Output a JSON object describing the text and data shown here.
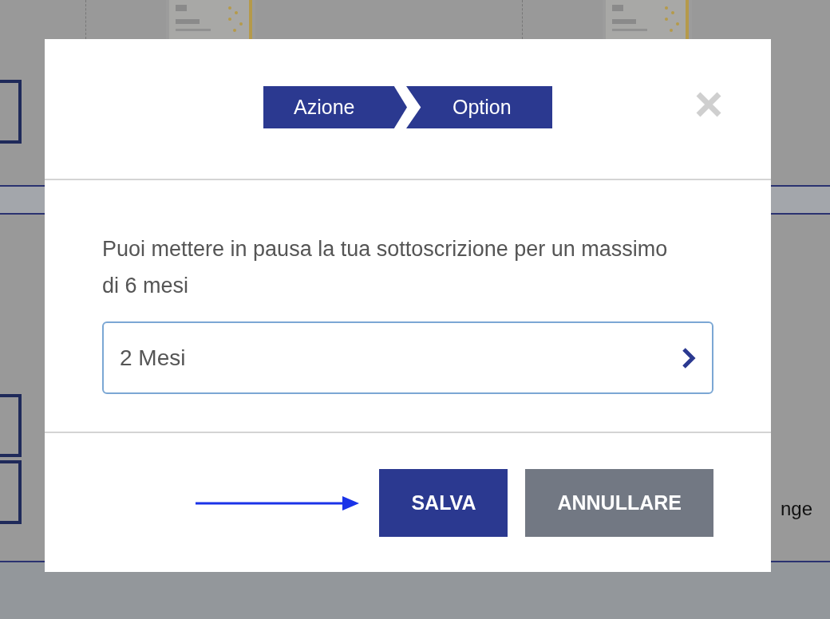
{
  "background": {
    "side_text": "nge"
  },
  "dialog": {
    "steps": [
      {
        "label": "Azione"
      },
      {
        "label": "Option"
      }
    ],
    "message": "Puoi mettere in pausa la tua sottoscrizione per un massimo di 6 mesi",
    "select": {
      "value": "2 Mesi"
    },
    "buttons": [
      {
        "label": "SALVA",
        "kind": "primary"
      },
      {
        "label": "ANNULLARE",
        "kind": "secondary"
      }
    ]
  }
}
